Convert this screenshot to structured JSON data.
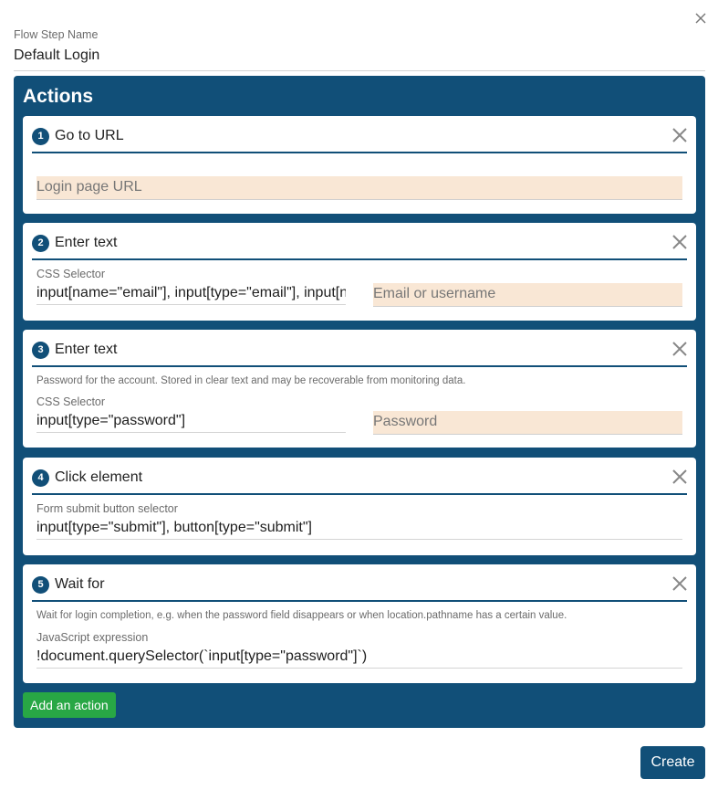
{
  "modal": {
    "close_icon": "close-icon",
    "name_field": {
      "label": "Flow Step Name",
      "value": "Default Login"
    }
  },
  "actions": {
    "title": "Actions",
    "items": [
      {
        "number": "1",
        "title": "Go to URL",
        "inputs": [
          {
            "placeholder": "Login page URL",
            "value": ""
          }
        ]
      },
      {
        "number": "2",
        "title": "Enter text",
        "selector_label": "CSS Selector",
        "selector_value": "input[name=\"email\"], input[type=\"email\"], input[name=\"username\"]",
        "text_placeholder": "Email or username"
      },
      {
        "number": "3",
        "title": "Enter text",
        "hint": "Password for the account. Stored in clear text and may be recoverable from monitoring data.",
        "selector_label": "CSS Selector",
        "selector_value": "input[type=\"password\"]",
        "text_placeholder": "Password"
      },
      {
        "number": "4",
        "title": "Click element",
        "selector_label": "Form submit button selector",
        "selector_value": "input[type=\"submit\"], button[type=\"submit\"]"
      },
      {
        "number": "5",
        "title": "Wait for",
        "hint": "Wait for login completion, e.g. when the password field disappears or when location.pathname has a certain value.",
        "expression_label": "JavaScript expression",
        "expression_value": "!document.querySelector(`input[type=\"password\"]`)"
      }
    ],
    "add_button": "Add an action"
  },
  "footer": {
    "create_button": "Create"
  },
  "colors": {
    "primary": "#114f78",
    "success": "#28a745",
    "required_field": "#f9e7d5"
  }
}
